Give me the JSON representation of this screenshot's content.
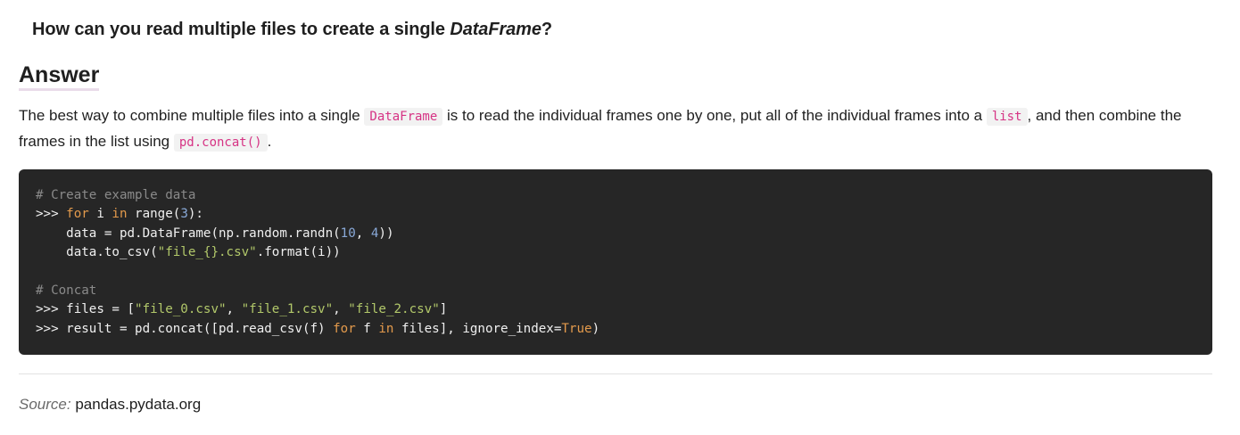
{
  "question": {
    "prefix": "How can you read multiple files to create a single ",
    "emphasis": "DataFrame",
    "suffix": "?"
  },
  "answer_heading": "Answer",
  "paragraph": {
    "part1": "The best way to combine multiple files into a single ",
    "code1": "DataFrame",
    "part2": " is to read the individual frames one by one, put all of the individual frames into a ",
    "code2": "list",
    "part3": ", and then combine the frames in the list using ",
    "code3": "pd.concat()",
    "part4": "."
  },
  "code_block": {
    "lines": [
      [
        {
          "t": "# Create example data",
          "c": "comment"
        }
      ],
      [
        {
          "t": ">>> ",
          "c": "plain"
        },
        {
          "t": "for",
          "c": "keyword"
        },
        {
          "t": " i ",
          "c": "plain"
        },
        {
          "t": "in",
          "c": "keyword"
        },
        {
          "t": " range(",
          "c": "plain"
        },
        {
          "t": "3",
          "c": "number"
        },
        {
          "t": "):",
          "c": "plain"
        }
      ],
      [
        {
          "t": "    data = pd.DataFrame(np.random.randn(",
          "c": "plain"
        },
        {
          "t": "10",
          "c": "number"
        },
        {
          "t": ", ",
          "c": "plain"
        },
        {
          "t": "4",
          "c": "number"
        },
        {
          "t": "))",
          "c": "plain"
        }
      ],
      [
        {
          "t": "    data.to_csv(",
          "c": "plain"
        },
        {
          "t": "\"file_{}.csv\"",
          "c": "string"
        },
        {
          "t": ".format(i))",
          "c": "plain"
        }
      ],
      [],
      [
        {
          "t": "# Concat",
          "c": "comment"
        }
      ],
      [
        {
          "t": ">>> files = [",
          "c": "plain"
        },
        {
          "t": "\"file_0.csv\"",
          "c": "string"
        },
        {
          "t": ", ",
          "c": "plain"
        },
        {
          "t": "\"file_1.csv\"",
          "c": "string"
        },
        {
          "t": ", ",
          "c": "plain"
        },
        {
          "t": "\"file_2.csv\"",
          "c": "string"
        },
        {
          "t": "]",
          "c": "plain"
        }
      ],
      [
        {
          "t": ">>> result = pd.concat([pd.read_csv(f) ",
          "c": "plain"
        },
        {
          "t": "for",
          "c": "keyword"
        },
        {
          "t": " f ",
          "c": "plain"
        },
        {
          "t": "in",
          "c": "keyword"
        },
        {
          "t": " files], ignore_index=",
          "c": "plain"
        },
        {
          "t": "True",
          "c": "keyword"
        },
        {
          "t": ")",
          "c": "plain"
        }
      ]
    ]
  },
  "source": {
    "label": "Source:",
    "value": "pandas.pydata.org"
  }
}
